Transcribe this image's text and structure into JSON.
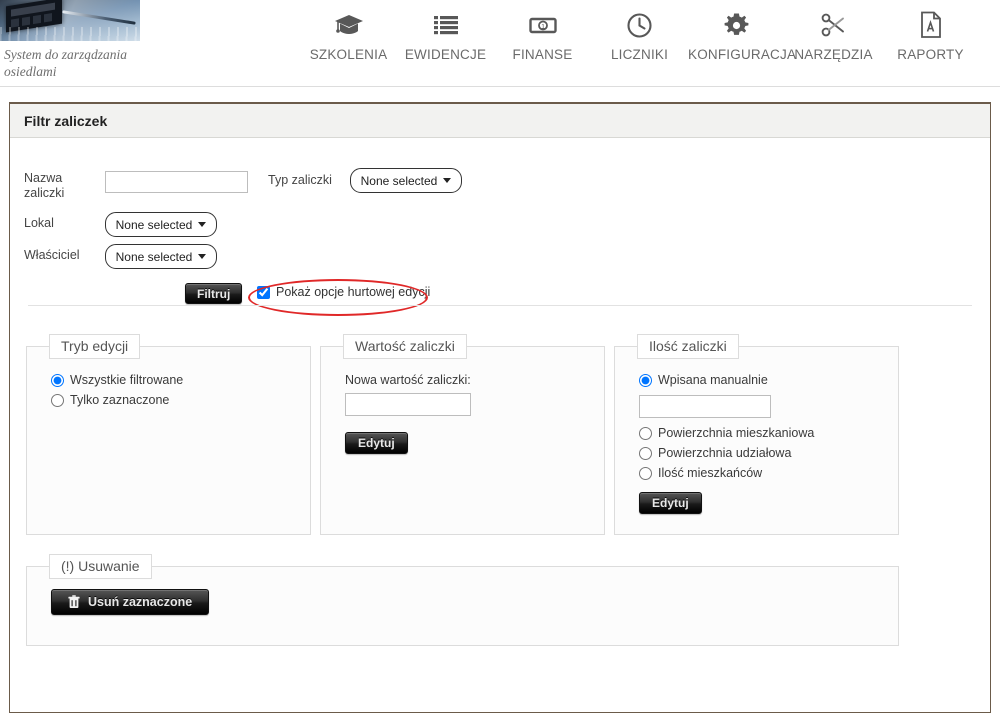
{
  "brand": {
    "image_name": "calculator-documents-photo",
    "tagline": "System do zarządzania osiedlami"
  },
  "nav": {
    "items": [
      {
        "label": "SZKOLENIA",
        "icon": "graduation-cap-icon"
      },
      {
        "label": "EWIDENCJE",
        "icon": "list-icon"
      },
      {
        "label": "FINANSE",
        "icon": "banknote-icon"
      },
      {
        "label": "LICZNIKI",
        "icon": "clock-icon"
      },
      {
        "label": "KONFIGURACJA",
        "icon": "gear-icon"
      },
      {
        "label": "NARZĘDZIA",
        "icon": "scissors-icon"
      },
      {
        "label": "RAPORTY",
        "icon": "pdf-document-icon"
      }
    ]
  },
  "panel": {
    "title": "Filtr zaliczek"
  },
  "filter": {
    "nazwa_label": "Nazwa zaliczki",
    "nazwa_value": "",
    "nazwa_placeholder": "",
    "typ_label": "Typ zaliczki",
    "typ_value": "None selected",
    "lokal_label": "Lokal",
    "lokal_value": "None selected",
    "wlasciciel_label": "Właściciel",
    "wlasciciel_value": "None selected",
    "filtruj_label": "Filtruj",
    "bulk_checkbox_label": "Pokaż opcje hurtowej edycji",
    "bulk_checkbox_checked": true,
    "highlight_color": "#e02828"
  },
  "tryb_edycji": {
    "legend": "Tryb edycji",
    "options": [
      {
        "label": "Wszystkie filtrowane",
        "selected": true
      },
      {
        "label": "Tylko zaznaczone",
        "selected": false
      }
    ]
  },
  "wartosc_zaliczki": {
    "legend": "Wartość zaliczki",
    "field_label": "Nowa wartość zaliczki:",
    "field_value": "",
    "field_placeholder": "",
    "button_label": "Edytuj"
  },
  "ilosc_zaliczki": {
    "legend": "Ilość zaliczki",
    "options": [
      {
        "label": "Wpisana manualnie",
        "selected": true
      },
      {
        "label": "Powierzchnia mieszkaniowa",
        "selected": false
      },
      {
        "label": "Powierzchnia udziałowa",
        "selected": false
      },
      {
        "label": "Ilość mieszkańców",
        "selected": false
      }
    ],
    "manual_value": "",
    "manual_placeholder": "",
    "button_label": "Edytuj"
  },
  "usuwanie": {
    "legend": "(!) Usuwanie",
    "button_label": "Usuń zaznaczone",
    "button_icon": "trash-icon"
  }
}
